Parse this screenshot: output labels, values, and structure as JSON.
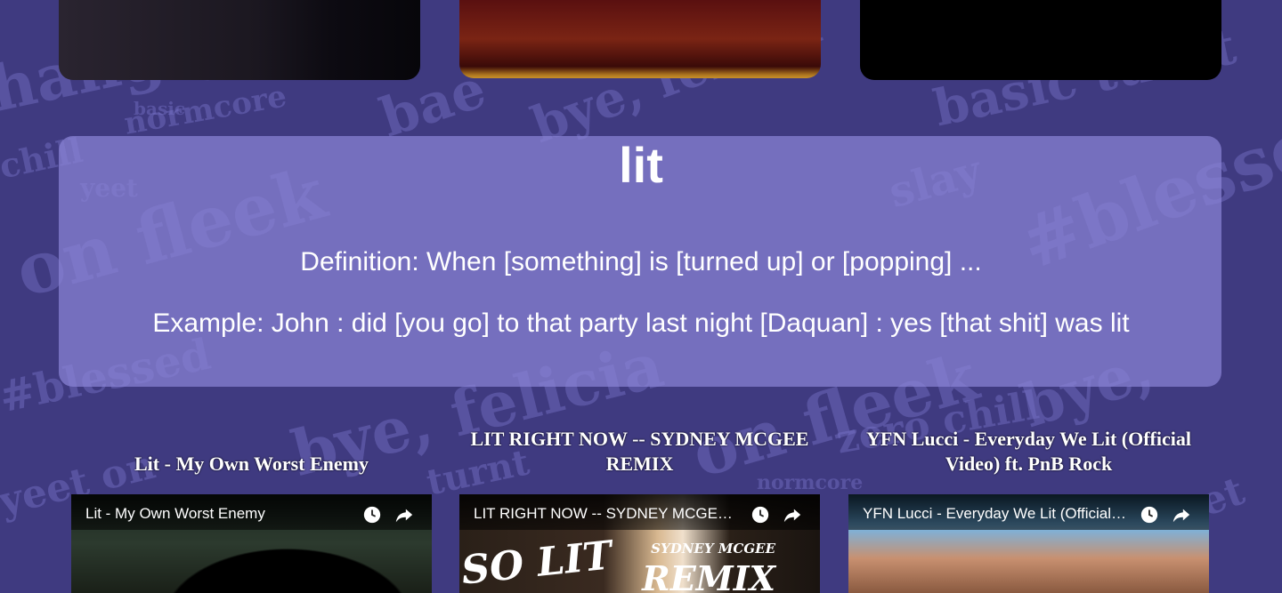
{
  "definition": {
    "word": "lit",
    "definition_text": "Definition: When [something] is [turned up] or [popping] ...",
    "example_text": "Example: John : did [you go] to that party last night [Daquan] : yes [that shit] was lit"
  },
  "videos": [
    {
      "heading": "Lit - My Own Worst Enemy",
      "player_title": "Lit - My Own Worst Enemy"
    },
    {
      "heading": "LIT RIGHT NOW -- SYDNEY MCGEE REMIX",
      "player_title": "LIT RIGHT NOW -- SYDNEY MCGEE REMIX",
      "thumb_left": "SO LIT",
      "thumb_right_small": "SYDNEY MCGEE",
      "thumb_right_large": "REMIX"
    },
    {
      "heading": "YFN Lucci - Everyday We Lit (Official Video) ft. PnB Rock",
      "player_title": "YFN Lucci - Everyday We Lit (Official Video) ft. PnB Rock"
    }
  ],
  "icons": {
    "watch_later": "clock-icon",
    "share": "share-arrow-icon"
  },
  "colors": {
    "background": "#3f3a80",
    "card": "#8a84d6",
    "text": "#ffffff"
  }
}
